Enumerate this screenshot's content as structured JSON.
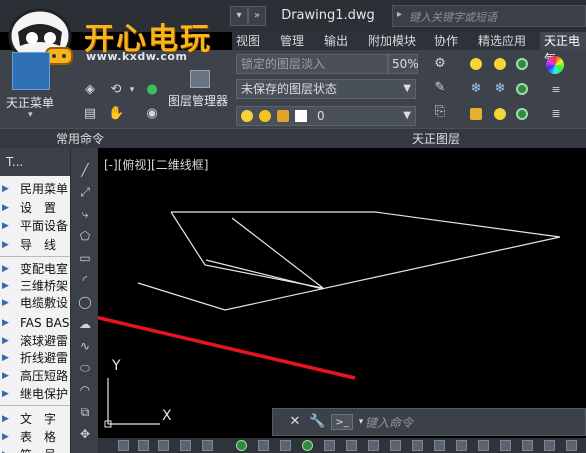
{
  "logo": {
    "title": "开心电玩",
    "url": "www.kxdw.com"
  },
  "window": {
    "document_title": "Drawing1.dwg",
    "search_placeholder": "键入关键字或短语"
  },
  "ribbon_tabs": [
    "视图",
    "管理",
    "输出",
    "附加模块",
    "协作",
    "精选应用",
    "天正电气"
  ],
  "ribbon": {
    "tz_menu_label": "天正菜单",
    "common_commands_label": "常用命令",
    "layer_manager_label": "图层管理器",
    "tz_layer_label": "天正图层",
    "layer_locked_text": "锁定的图层淡入",
    "layer_fade_percent": "50%",
    "layer_state": "未保存的图层状态",
    "current_layer": "0"
  },
  "palette": {
    "title": "T...",
    "items": [
      "民用菜单",
      "设　置",
      "平面设备",
      "导　线",
      "变配电室",
      "三维桥架",
      "电缆敷设",
      "FAS BAS",
      "滚球避雷",
      "折线避雷",
      "高压短路",
      "继电保护",
      "文　字",
      "表　格",
      "符　号"
    ]
  },
  "drawing": {
    "view_label": "[-][俯视][二维线框]",
    "ucs_x_label": "X",
    "ucs_y_label": "Y"
  },
  "command_line": {
    "placeholder": "键入命令"
  },
  "colors": {
    "ribbon_bg": "#3d424b",
    "palette_bg": "#f2f2f2",
    "arrow_red": "#e8141f",
    "logo_gold": "#f7b51b"
  }
}
